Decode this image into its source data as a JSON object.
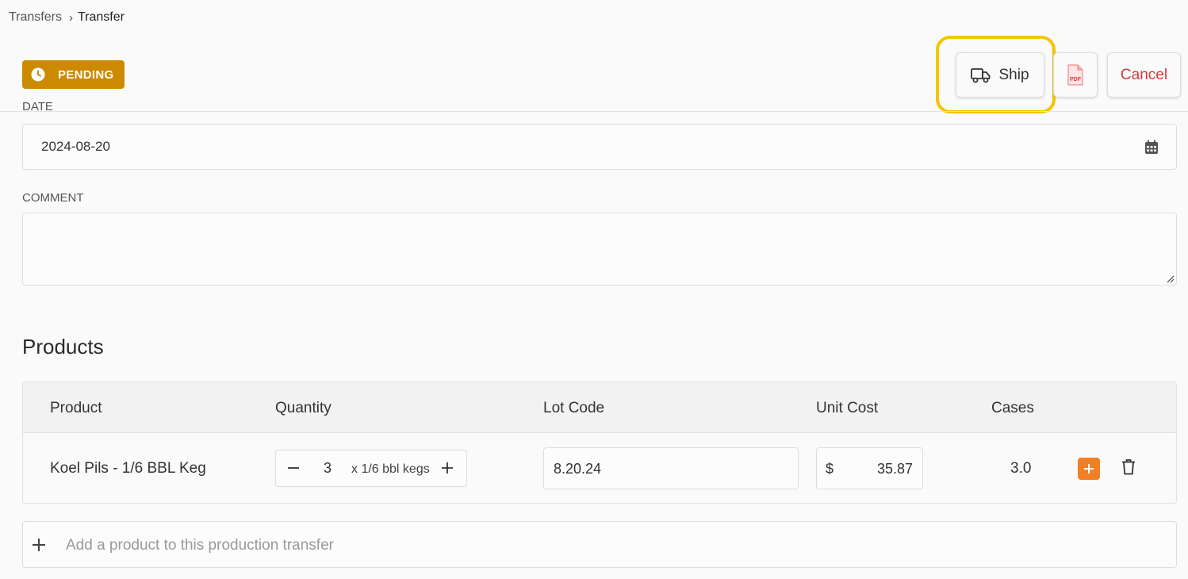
{
  "breadcrumb": {
    "parent": "Transfers",
    "current": "Transfer"
  },
  "status": {
    "label": "PENDING",
    "color": "#cc8a00",
    "icon": "clock-icon"
  },
  "actions": {
    "ship_label": "Ship",
    "ship_icon": "truck-icon",
    "pdf_icon": "pdf-icon",
    "cancel_label": "Cancel",
    "cancel_color": "#d23a3a",
    "highlight_color": "#f5c400"
  },
  "form": {
    "date_label": "DATE",
    "date_value": "2024-08-20",
    "comment_label": "COMMENT",
    "comment_value": ""
  },
  "products": {
    "title": "Products",
    "columns": [
      "Product",
      "Quantity",
      "Lot Code",
      "Unit Cost",
      "Cases"
    ],
    "rows": [
      {
        "product": "Koel Pils - 1/6 BBL Keg",
        "quantity": "3",
        "unit": "x 1/6 bbl kegs",
        "lot_code": "8.20.24",
        "currency": "$",
        "unit_cost": "35.87",
        "cases": "3.0"
      }
    ],
    "add_placeholder": "Add a product to this production transfer",
    "accent": "#f28024"
  }
}
